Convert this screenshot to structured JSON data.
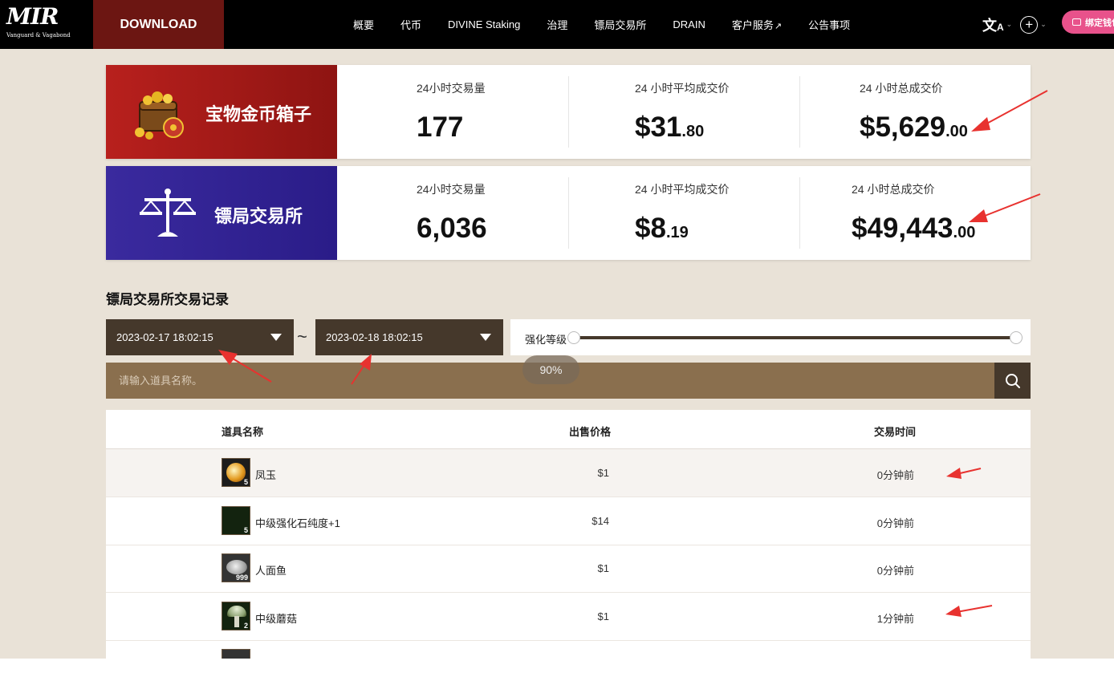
{
  "header": {
    "logo_text": "MIR",
    "logo_subtitle": "Vanguard & Vagabond",
    "download_label": "DOWNLOAD",
    "nav": [
      "概要",
      "代币",
      "DIVINE Staking",
      "治理",
      "镖局交易所",
      "DRAIN",
      "客户服务",
      "公告事项"
    ],
    "wallet_button": "绑定钱包"
  },
  "stats": [
    {
      "banner_title": "宝物金币箱子",
      "icon": "treasure-chest",
      "accent": "#b8201d",
      "volume_label": "24小时交易量",
      "volume": "177",
      "avg_label": "24 小时平均成交价",
      "avg_main": "$31",
      "avg_cents": ".80",
      "total_label": "24 小时总成交价",
      "total_main": "$5,629",
      "total_cents": ".00"
    },
    {
      "banner_title": "镖局交易所",
      "icon": "balance-scale",
      "accent": "#2a1c88",
      "volume_label": "24小时交易量",
      "volume": "6,036",
      "avg_label": "24 小时平均成交价",
      "avg_main": "$8",
      "avg_cents": ".19",
      "total_label": "24 小时总成交价",
      "total_main": "$49,443",
      "total_cents": ".00"
    }
  ],
  "records": {
    "title": "镖局交易所交易记录",
    "date_from": "2023-02-17 18:02:15",
    "date_to": "2023-02-18 18:02:15",
    "separator": "~",
    "level_label": "强化等级",
    "zoom": "90%",
    "search_placeholder": "请输入道具名称。",
    "columns": {
      "name": "道具名称",
      "price": "出售价格",
      "time": "交易时间"
    },
    "rows": [
      {
        "name": "凤玉",
        "qty": "5",
        "price": "$1",
        "time": "0分钟前",
        "icon": "orb"
      },
      {
        "name": "中级强化石纯度+1",
        "qty": "5",
        "price": "$14",
        "time": "0分钟前",
        "icon": "stone"
      },
      {
        "name": "人面鱼",
        "qty": "999",
        "price": "$1",
        "time": "0分钟前",
        "icon": "fish"
      },
      {
        "name": "中级蘑菇",
        "qty": "2",
        "price": "$1",
        "time": "1分钟前",
        "icon": "mushroom"
      }
    ]
  },
  "annotation_color": "#e8322f"
}
